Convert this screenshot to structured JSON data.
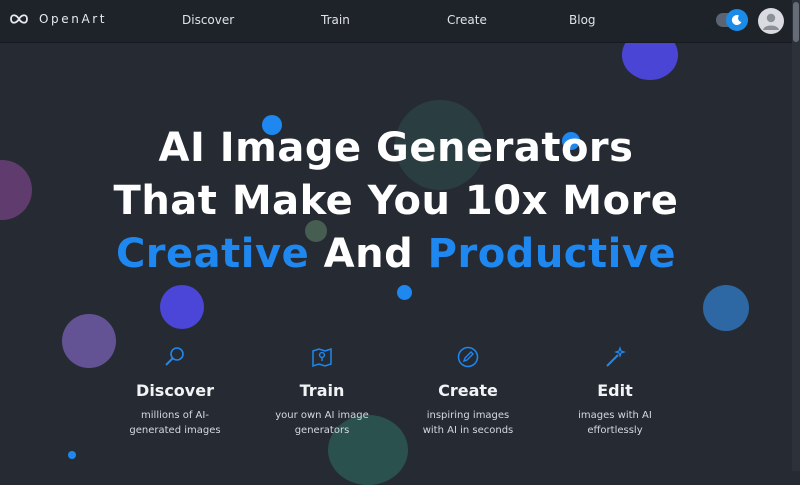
{
  "brand": {
    "name": "OpenArt"
  },
  "nav": {
    "links": [
      "Discover",
      "Train",
      "Create",
      "Blog"
    ]
  },
  "icons": {
    "logo": "infinity-logo-icon",
    "theme": "moon-icon",
    "avatar": "user-icon",
    "discover": "magnifier-icon",
    "train": "map-icon",
    "create": "pencil-icon",
    "edit": "magic-wand-icon"
  },
  "colors": {
    "accent": "#1e88f0",
    "background": "#262b33",
    "nav": "#1e232a"
  },
  "hero": {
    "line1": "AI Image Generators",
    "line2": "That Make You 10x More",
    "creative": "Creative",
    "and": "And",
    "productive": "Productive"
  },
  "features": [
    {
      "title": "Discover",
      "desc_line1": "millions of AI-",
      "desc_line2": "generated images"
    },
    {
      "title": "Train",
      "desc_line1": "your own AI image",
      "desc_line2": "generators"
    },
    {
      "title": "Create",
      "desc_line1": "inspiring images",
      "desc_line2": "with AI in seconds"
    },
    {
      "title": "Edit",
      "desc_line1": "images with AI",
      "desc_line2": "effortlessly"
    }
  ]
}
